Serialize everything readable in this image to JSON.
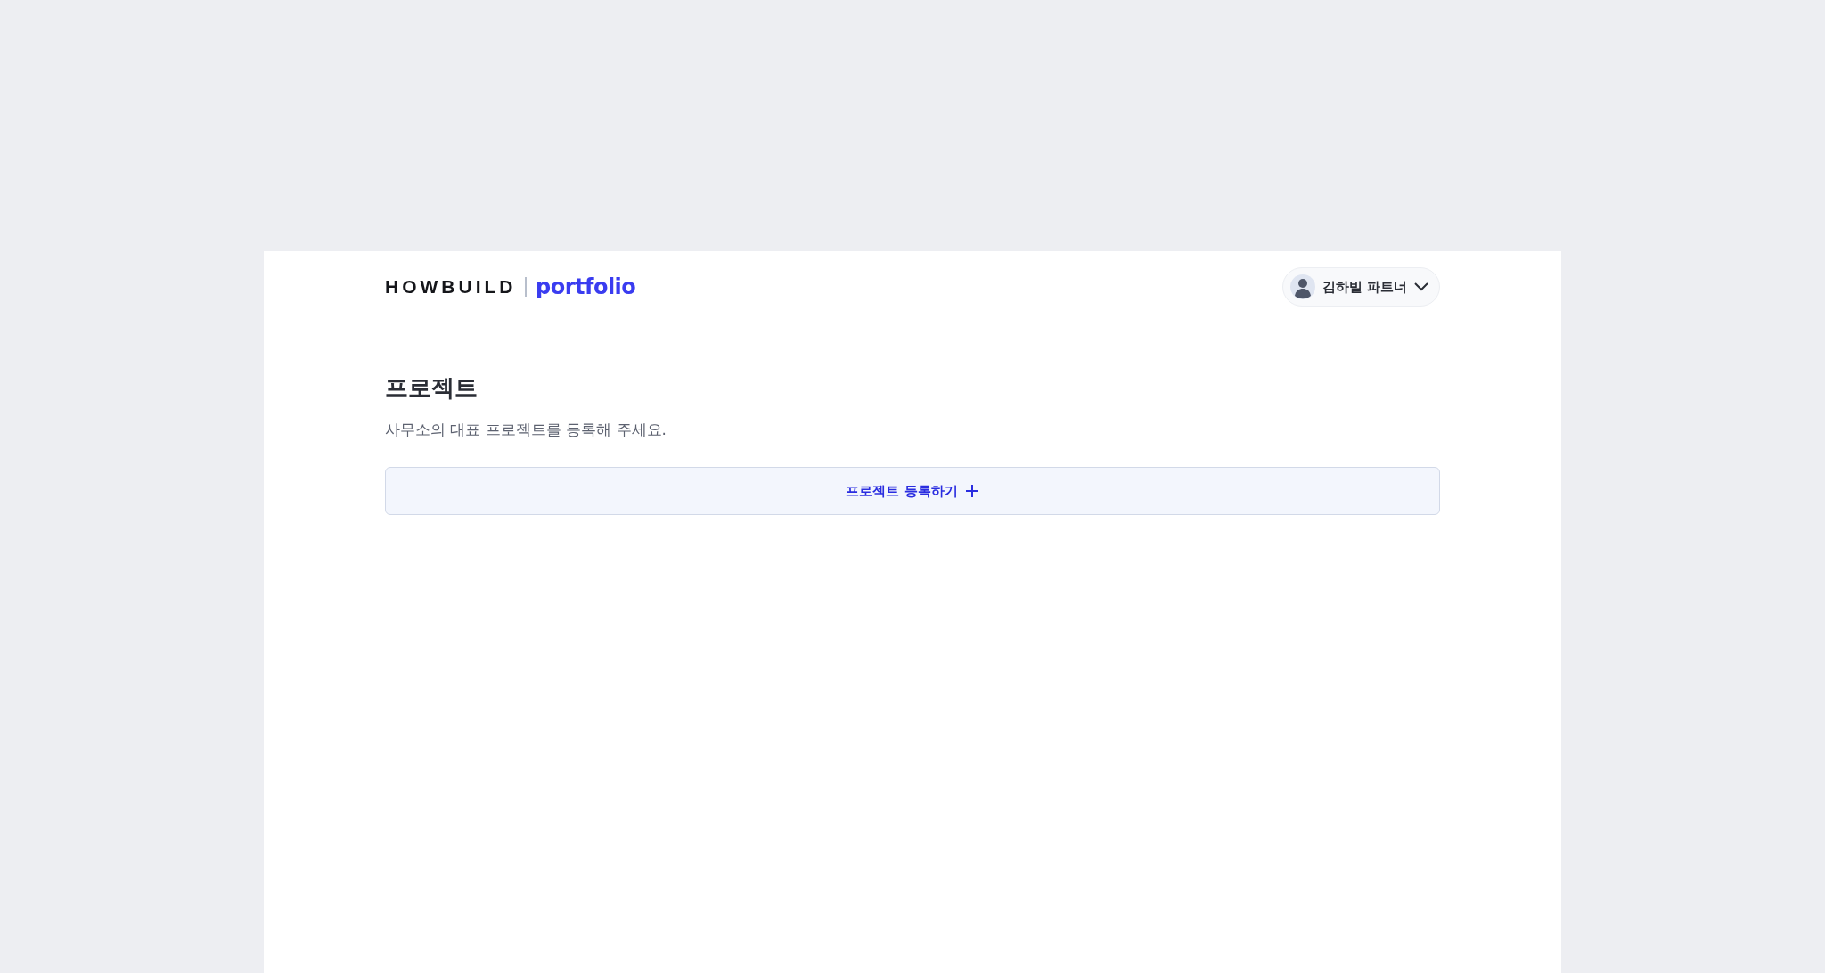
{
  "header": {
    "logo": {
      "brand": "HOWBUILD",
      "product": "portfolio"
    },
    "user_menu": {
      "name": "김하빌 파트너"
    }
  },
  "section": {
    "title": "프로젝트",
    "description": "사무소의 대표 프로젝트를 등록해 주세요.",
    "add_button": {
      "label": "프로젝트 등록하기"
    }
  }
}
